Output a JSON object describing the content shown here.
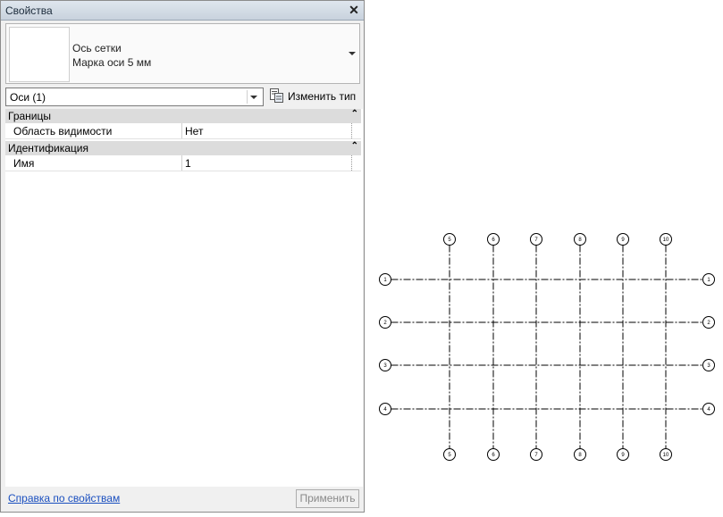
{
  "palette": {
    "title": "Свойства",
    "close_glyph": "✕",
    "type_selector": {
      "family": "Ось сетки",
      "type": "Марка оси 5 мм"
    },
    "instance_filter": "Оси (1)",
    "edit_type_label": "Изменить тип",
    "groups": [
      {
        "name": "Границы",
        "collapse_glyph": "⌃",
        "properties": [
          {
            "name": "Область видимости",
            "value": "Нет"
          }
        ]
      },
      {
        "name": "Идентификация",
        "collapse_glyph": "⌃",
        "properties": [
          {
            "name": "Имя",
            "value": "1"
          }
        ]
      }
    ],
    "help_link": "Справка по свойствам",
    "apply_button": "Применить"
  },
  "drawing": {
    "vertical_grids": [
      "5",
      "6",
      "7",
      "8",
      "9",
      "10"
    ],
    "horizontal_grids": [
      "1",
      "2",
      "3",
      "4"
    ],
    "line_color": "#000000"
  }
}
